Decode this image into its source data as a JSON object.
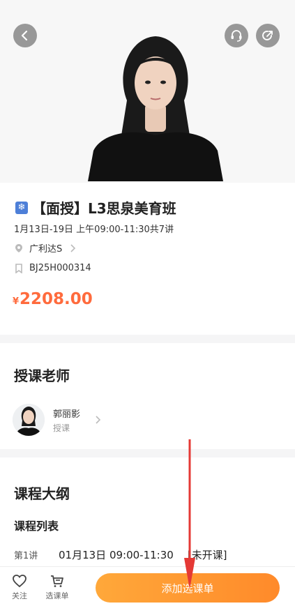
{
  "course": {
    "badge_icon": "snowflake-icon",
    "title": "【面授】L3思泉美育班",
    "schedule": "1月13日-19日  上午09:00-11:30共7讲",
    "location": "广利达S",
    "code": "BJ25H000314",
    "price_symbol": "¥",
    "price": "2208.00"
  },
  "teacher_section": {
    "title": "授课老师",
    "teacher": {
      "name": "郭丽影",
      "role": "授课"
    }
  },
  "outline": {
    "title": "课程大纲",
    "list_title": "课程列表",
    "lessons": [
      {
        "index": "第1讲",
        "time": "01月13日 09:00-11:30",
        "status": "[未开课]"
      }
    ]
  },
  "bottom_bar": {
    "follow_label": "关注",
    "cart_label": "选课单",
    "add_button": "添加选课单"
  },
  "colors": {
    "accent_orange": "#ff8a2a",
    "price_color": "#ff6b3d",
    "annotation_red": "#e53935"
  }
}
